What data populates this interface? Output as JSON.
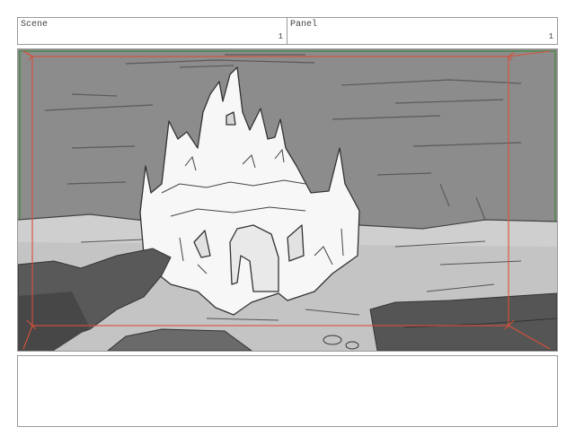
{
  "header": {
    "scene_label": "Scene",
    "scene_number": "1",
    "panel_label": "Panel",
    "panel_number": "1"
  },
  "panel": {
    "image_icon": "castle-sketch",
    "safe_frame_color": "#d9503a",
    "border_color": "#4f8a4f"
  },
  "notes": {
    "text": ""
  }
}
